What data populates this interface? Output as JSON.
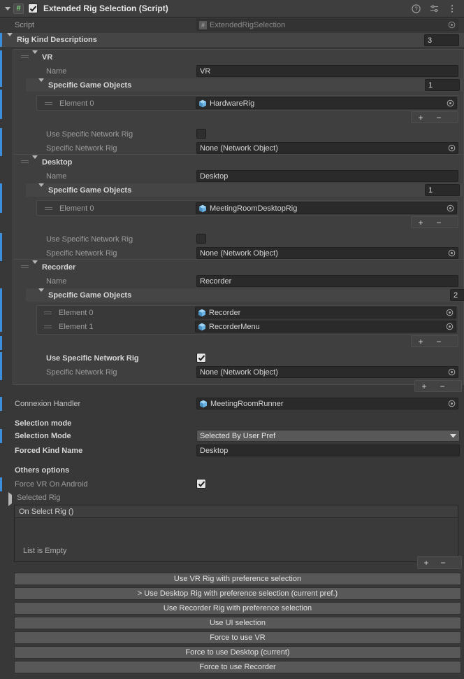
{
  "header": {
    "title": "Extended Rig Selection (Script)",
    "enabled_checkbox": true,
    "script_badge": "#",
    "icons": [
      "help-icon",
      "preset-icon",
      "menu-icon"
    ]
  },
  "script_row": {
    "label": "Script",
    "value": "ExtendedRigSelection"
  },
  "rig_kind_descriptions": {
    "label": "Rig Kind Descriptions",
    "size": "3",
    "items": [
      {
        "title": "VR",
        "name_label": "Name",
        "name_value": "VR",
        "array_label": "Specific Game Objects",
        "array_size": "1",
        "elements": [
          {
            "label": "Element 0",
            "value": "HardwareRig"
          }
        ],
        "use_specific_label": "Use Specific Network Rig",
        "use_specific_checked": false,
        "specific_rig_label": "Specific Network Rig",
        "specific_rig_value": "None (Network Object)"
      },
      {
        "title": "Desktop",
        "name_label": "Name",
        "name_value": "Desktop",
        "array_label": "Specific Game Objects",
        "array_size": "1",
        "elements": [
          {
            "label": "Element 0",
            "value": "MeetingRoomDesktopRig"
          }
        ],
        "use_specific_label": "Use Specific Network Rig",
        "use_specific_checked": false,
        "specific_rig_label": "Specific Network Rig",
        "specific_rig_value": "None (Network Object)"
      },
      {
        "title": "Recorder",
        "name_label": "Name",
        "name_value": "Recorder",
        "array_label": "Specific Game Objects",
        "array_size": "2",
        "elements": [
          {
            "label": "Element 0",
            "value": "Recorder"
          },
          {
            "label": "Element 1",
            "value": "RecorderMenu"
          }
        ],
        "use_specific_label": "Use Specific Network Rig",
        "use_specific_checked": true,
        "specific_rig_label": "Specific Network Rig",
        "specific_rig_value": "None (Network Object)"
      }
    ]
  },
  "connexion_handler": {
    "label": "Connexion Handler",
    "value": "MeetingRoomRunner"
  },
  "selection_mode_section": {
    "header": "Selection mode",
    "selection_mode_label": "Selection Mode",
    "selection_mode_value": "Selected By User Pref",
    "forced_kind_label": "Forced Kind Name",
    "forced_kind_value": "Desktop"
  },
  "others_options": {
    "header": "Others options",
    "force_vr_label": "Force VR On Android",
    "force_vr_checked": true,
    "selected_rig_label": "Selected Rig"
  },
  "event_list": {
    "header": "On Select Rig ()",
    "empty_text": "List is Empty",
    "add_label": "+",
    "remove_label": "−"
  },
  "array_buttons": {
    "add": "+",
    "remove": "−"
  },
  "action_buttons": [
    "Use VR Rig with preference selection",
    "> Use Desktop Rig with preference selection (current pref.)",
    "Use Recorder Rig with preference selection",
    "Use UI selection",
    "Force to use VR",
    "Force to use Desktop  (current)",
    "Force to use Recorder"
  ],
  "colors": {
    "background": "#383838",
    "header_bg": "#3e3e3e",
    "field_bg": "#2a2a2a",
    "button_bg": "#585858",
    "override_marker": "#3c8ddc",
    "prefab_blue": "#6cb4e4",
    "text": "#c4c4c4"
  }
}
